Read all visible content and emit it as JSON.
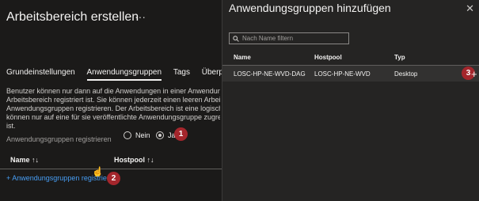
{
  "left": {
    "title": "Arbeitsbereich erstellen",
    "more": "···",
    "tabs": [
      "Grundeinstellungen",
      "Anwendungsgruppen",
      "Tags",
      "Überprüfen + e"
    ],
    "description": [
      "Benutzer können nur dann auf die Anwendungen in einer Anwendungsgruppe z",
      "Arbeitsbereich registriert ist. Sie können jederzeit einen leeren Arbeitsbereich e",
      "Anwendungsgruppen registrieren. Der Arbeitsbereich ist eine logische Gruppier",
      "können nur auf eine für sie veröffentlichte Anwendungsgruppe zugreifen, wenn",
      "ist."
    ],
    "register_label": "Anwendungsgruppen registrieren",
    "radio_no": "Nein",
    "radio_yes": "Ja",
    "radio_selected": "Ja",
    "table_headers": [
      "Name ↑↓",
      "Hostpool ↑↓"
    ],
    "add_link": "+ Anwendungsgruppen registrieren",
    "badges": [
      "1",
      "2"
    ]
  },
  "panel": {
    "title": "Anwendungsgruppen hinzufügen",
    "close": "✕",
    "filter_placeholder": "Nach Name filtern",
    "headers": [
      "Name",
      "Hostpool",
      "Typ"
    ],
    "rows": [
      {
        "name": "LOSC-HP-NE-WVD-DAG",
        "hostpool": "LOSC-HP-NE-WVD",
        "type": "Desktop"
      }
    ],
    "badge": "3",
    "add": "+"
  }
}
